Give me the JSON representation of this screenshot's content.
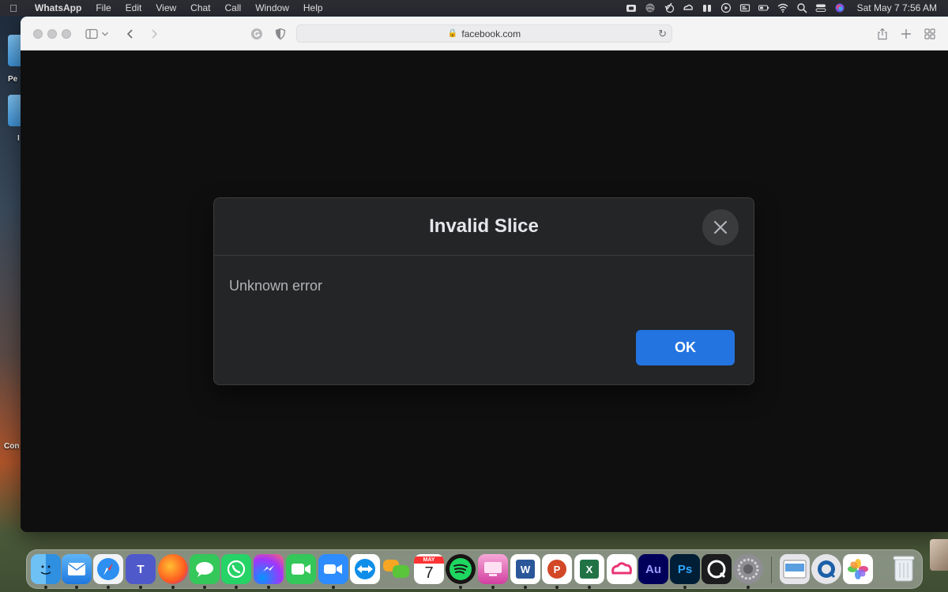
{
  "menubar": {
    "app_name": "WhatsApp",
    "items": [
      "File",
      "Edit",
      "View",
      "Chat",
      "Call",
      "Window",
      "Help"
    ],
    "clock": "Sat May 7  7:56 AM"
  },
  "desktop": {
    "labels": [
      "Pe",
      "I",
      "Con"
    ]
  },
  "browser": {
    "url": "facebook.com"
  },
  "dialog": {
    "title": "Invalid Slice",
    "message": "Unknown error",
    "ok_label": "OK"
  },
  "dock": {
    "calendar_month": "MAY",
    "calendar_day": "7",
    "apps": [
      "finder",
      "mail",
      "safari",
      "teams",
      "firefox",
      "messages",
      "whatsapp",
      "messenger",
      "facetime",
      "zoom",
      "teamviewer",
      "chat-bubbles",
      "calendar",
      "spotify",
      "cleanmymac",
      "word",
      "powerpoint",
      "excel",
      "creative-cloud",
      "audition",
      "photoshop",
      "quicktime",
      "system-preferences",
      "preview",
      "quicktime-player",
      "photos",
      "trash"
    ],
    "audition_label": "Au",
    "photoshop_label": "Ps",
    "word_label": "W",
    "powerpoint_label": "P",
    "excel_label": "X"
  }
}
